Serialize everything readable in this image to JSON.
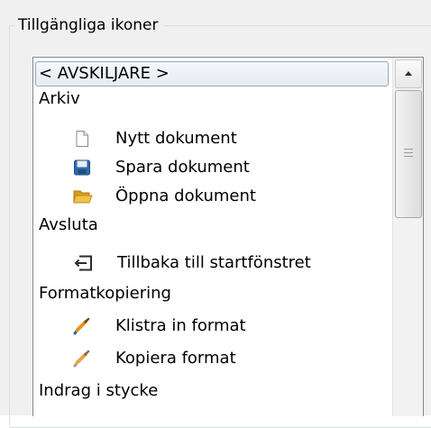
{
  "group": {
    "title": "Tillgängliga ikoner"
  },
  "items": [
    {
      "label": "< AVSKILJARE >",
      "icon": null,
      "selected": true
    },
    {
      "label": "Arkiv",
      "icon": null
    },
    {
      "label": "Nytt dokument",
      "icon": "new-document-icon"
    },
    {
      "label": "Spara dokument",
      "icon": "save-disk-icon"
    },
    {
      "label": "Öppna dokument",
      "icon": "open-folder-icon"
    },
    {
      "label": "Avsluta",
      "icon": null
    },
    {
      "label": "Tillbaka till startfönstret",
      "icon": "return-to-start-icon"
    },
    {
      "label": "Formatkopiering",
      "icon": null
    },
    {
      "label": "Klistra in format",
      "icon": "paste-format-icon"
    },
    {
      "label": "Kopiera format",
      "icon": "copy-format-icon"
    },
    {
      "label": "Indrag i stycke",
      "icon": null
    }
  ],
  "colors": {
    "selection_border": "#9aa7b6",
    "save_icon": "#2f6aa8",
    "folder_icon": "#e6a92a",
    "brush_icon": "#e2941c"
  }
}
